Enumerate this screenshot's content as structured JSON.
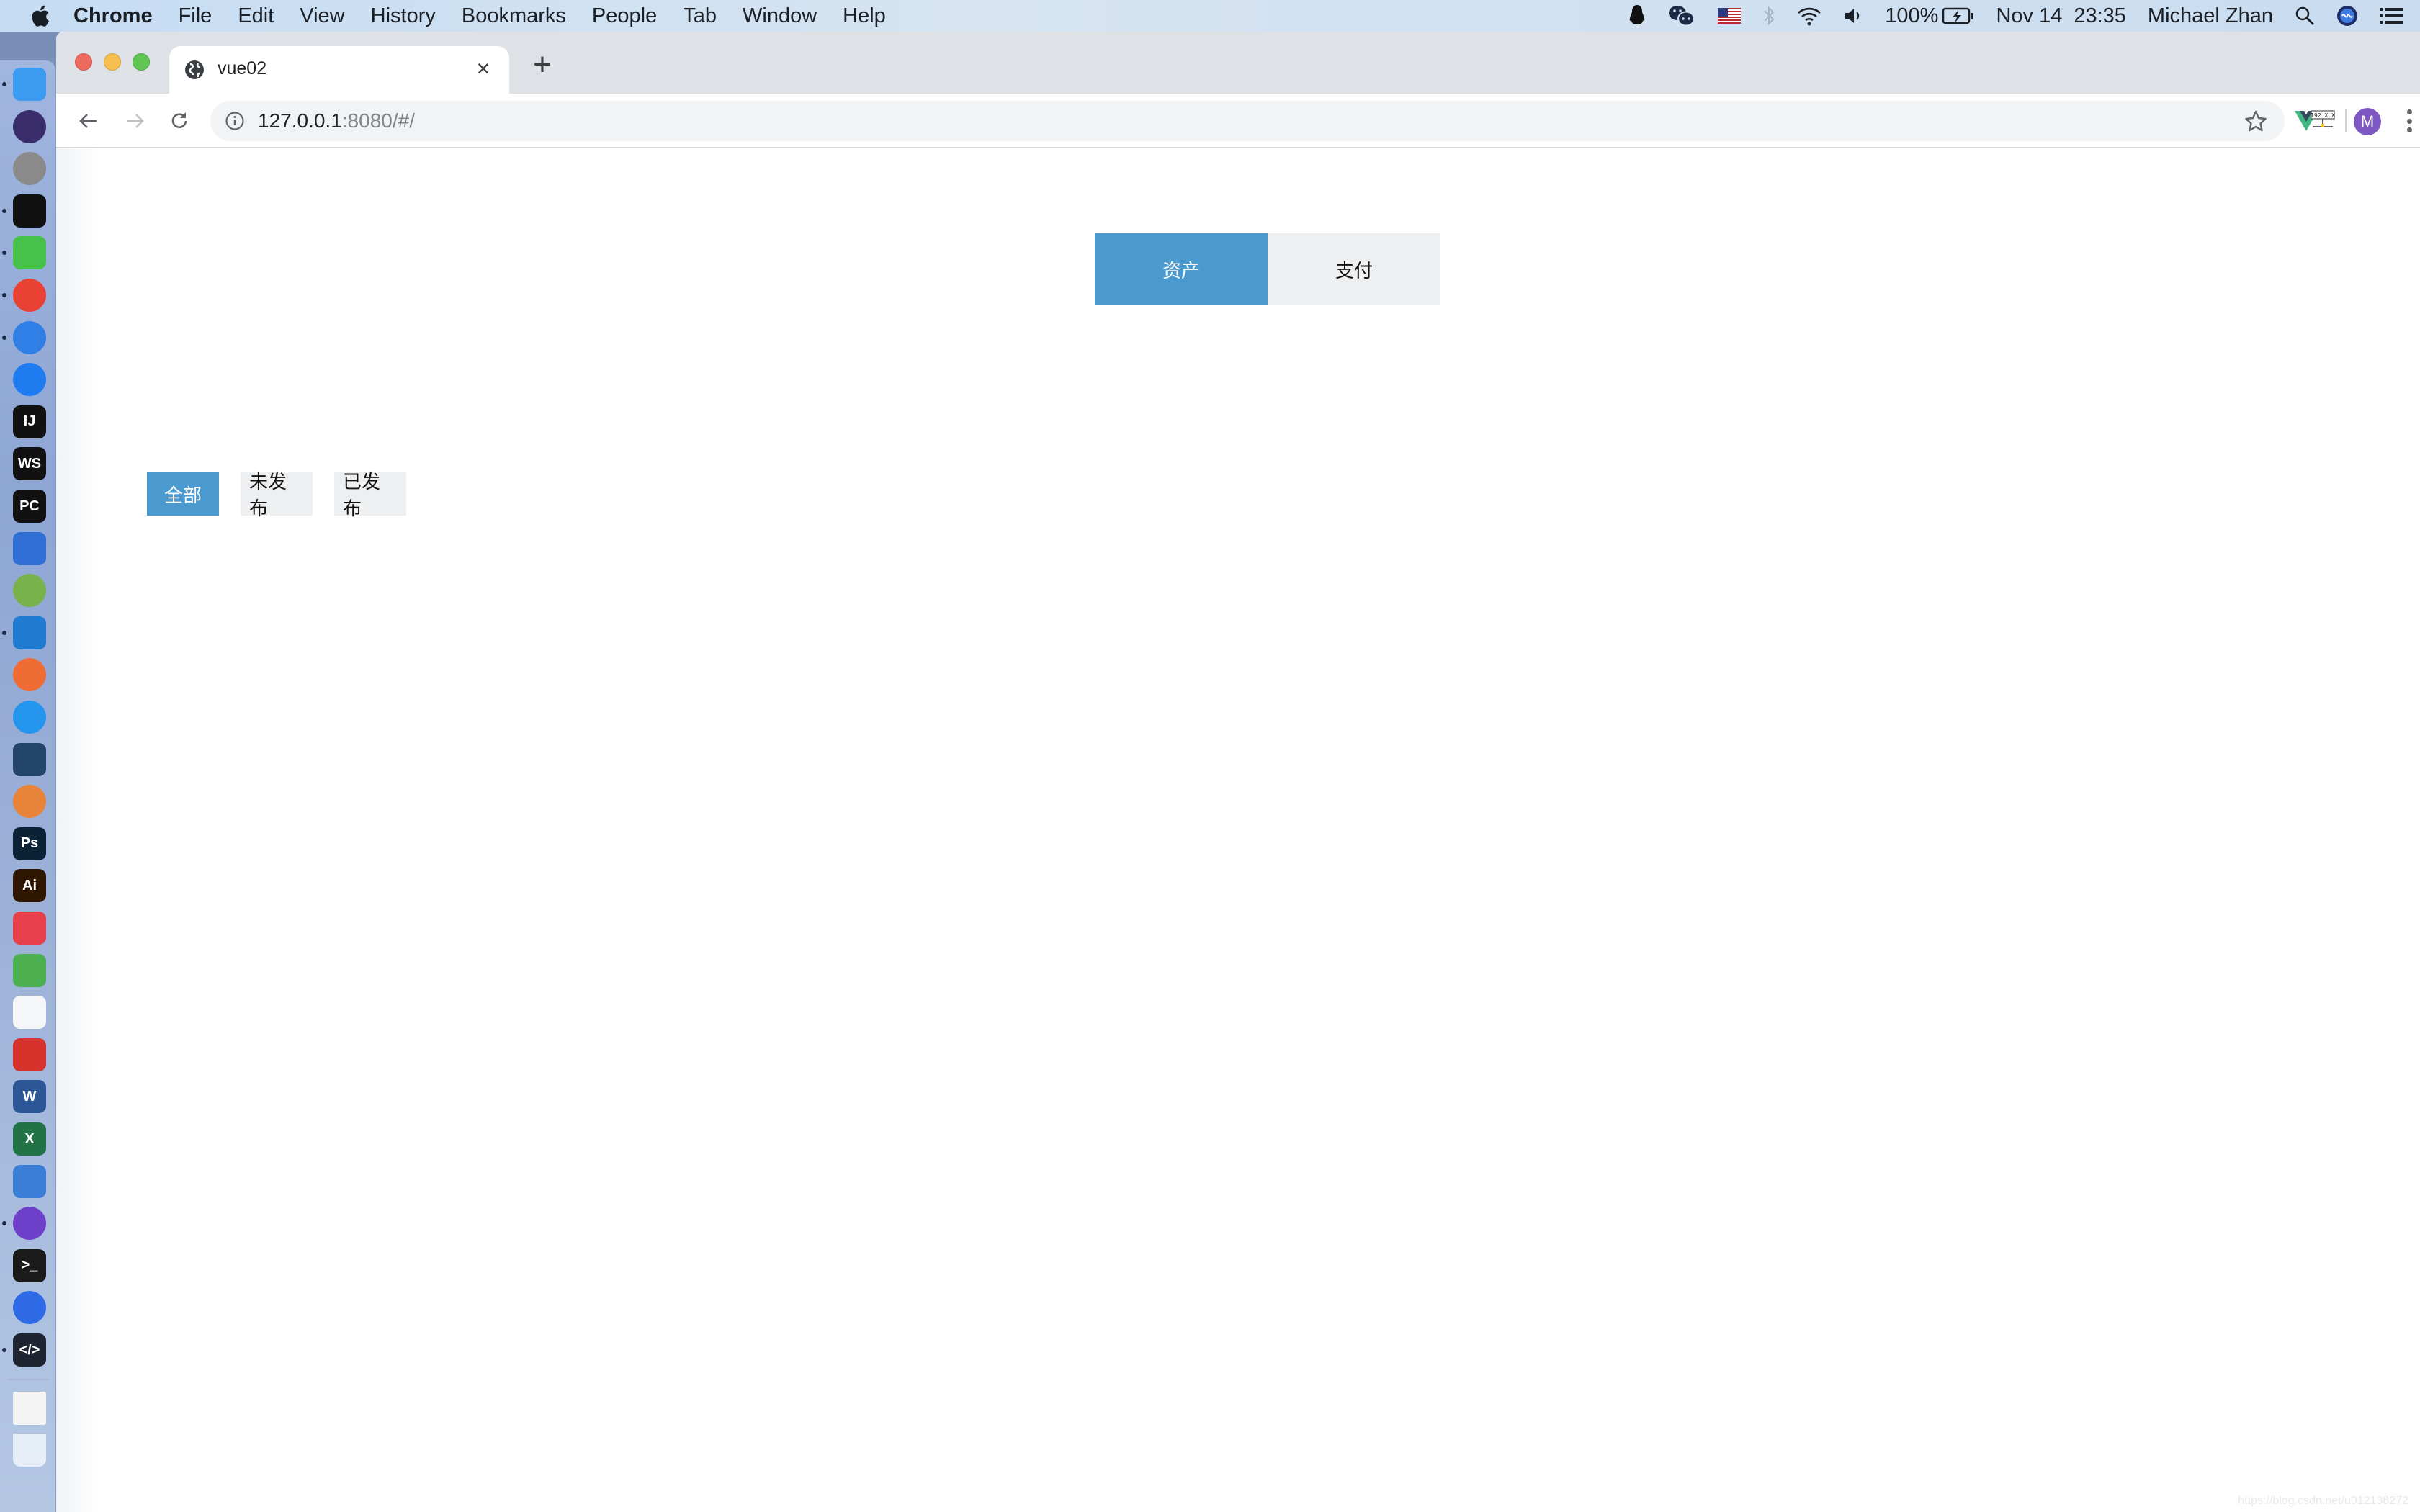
{
  "menubar": {
    "app_name": "Chrome",
    "items": [
      "File",
      "Edit",
      "View",
      "History",
      "Bookmarks",
      "People",
      "Tab",
      "Window",
      "Help"
    ],
    "status": {
      "battery": "100%",
      "date": "Nov 14",
      "time": "23:35",
      "user": "Michael Zhan"
    },
    "status_icons": [
      "qq-icon",
      "wechat-icon",
      "us-flag-icon",
      "bluetooth-icon",
      "wifi-icon",
      "volume-icon",
      "battery-icon",
      "spotlight-icon",
      "siri-icon",
      "notification-center-icon"
    ]
  },
  "dock": {
    "apps": [
      {
        "name": "finder",
        "label": "",
        "color": "#3b9bf0",
        "running": true
      },
      {
        "name": "siri",
        "label": "",
        "color": "#3a2d6b",
        "running": false
      },
      {
        "name": "launchpad",
        "label": "",
        "color": "#8a8a8a",
        "running": false
      },
      {
        "name": "qq",
        "label": "",
        "color": "#111111",
        "running": true
      },
      {
        "name": "wechat",
        "label": "",
        "color": "#46c24a",
        "running": true
      },
      {
        "name": "chrome",
        "label": "",
        "color": "#e94235",
        "running": true
      },
      {
        "name": "safari",
        "label": "",
        "color": "#2f7fe6",
        "running": true
      },
      {
        "name": "app-store",
        "label": "",
        "color": "#1e7cf0",
        "running": false
      },
      {
        "name": "intellij-idea",
        "label": "IJ",
        "color": "#111111",
        "running": false
      },
      {
        "name": "webstorm",
        "label": "WS",
        "color": "#111111",
        "running": false
      },
      {
        "name": "pycharm",
        "label": "PC",
        "color": "#111111",
        "running": false
      },
      {
        "name": "xcode",
        "label": "",
        "color": "#2f6fd6",
        "running": false
      },
      {
        "name": "android-studio",
        "label": "",
        "color": "#78b24b",
        "running": false
      },
      {
        "name": "vscode",
        "label": "",
        "color": "#1f7ad1",
        "running": true
      },
      {
        "name": "postman",
        "label": "",
        "color": "#ef6c35",
        "running": false
      },
      {
        "name": "docker",
        "label": "",
        "color": "#2496ed",
        "running": false
      },
      {
        "name": "mysql-workbench",
        "label": "",
        "color": "#24456b",
        "running": false
      },
      {
        "name": "navicat",
        "label": "",
        "color": "#e8843a",
        "running": false
      },
      {
        "name": "photoshop",
        "label": "Ps",
        "color": "#0b2236",
        "running": false
      },
      {
        "name": "illustrator",
        "label": "Ai",
        "color": "#2e1600",
        "running": false
      },
      {
        "name": "xmind",
        "label": "",
        "color": "#e8404a",
        "running": false
      },
      {
        "name": "mindnode",
        "label": "",
        "color": "#4caf50",
        "running": false
      },
      {
        "name": "xmind-zen",
        "label": "",
        "color": "#f4f6f8",
        "running": false
      },
      {
        "name": "netease-music",
        "label": "",
        "color": "#d7332c",
        "running": false
      },
      {
        "name": "word",
        "label": "W",
        "color": "#2b5797",
        "running": false
      },
      {
        "name": "excel",
        "label": "X",
        "color": "#217346",
        "running": false
      },
      {
        "name": "parallels",
        "label": "",
        "color": "#3a7ed8",
        "running": false
      },
      {
        "name": "github-desktop",
        "label": "",
        "color": "#6e40c9",
        "running": true
      },
      {
        "name": "terminal",
        "label": ">_",
        "color": "#1a1a1a",
        "running": false
      },
      {
        "name": "teamviewer",
        "label": "",
        "color": "#2f6ae6",
        "running": false
      },
      {
        "name": "code-editor",
        "label": "</>",
        "color": "#1e2430",
        "running": true
      }
    ],
    "extras": [
      "zip-archive-icon",
      "trash-icon"
    ]
  },
  "browser": {
    "tab_title": "vue02",
    "url_host": "127.0.0.1",
    "url_rest": ":8080/#/",
    "avatar_letter": "M"
  },
  "page": {
    "main_tabs": [
      {
        "label": "资产",
        "active": true
      },
      {
        "label": "支付",
        "active": false
      }
    ],
    "filters": [
      {
        "label": "全部",
        "active": true
      },
      {
        "label": "未发布",
        "active": false
      },
      {
        "label": "已发布",
        "active": false
      }
    ],
    "watermark": "https://blog.csdn.net/u012138272"
  },
  "colors": {
    "accent": "#4a9ad0",
    "inactive_bg": "#eeeff1"
  }
}
